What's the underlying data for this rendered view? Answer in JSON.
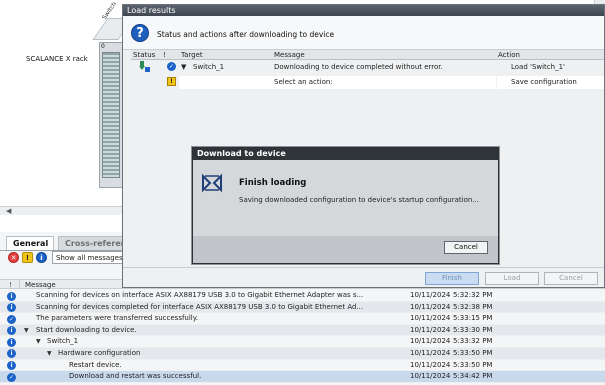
{
  "workspace": {
    "rack_label": "SCALANCE X rack",
    "rack_tab_label": "Switch",
    "rack_slot": "0"
  },
  "load_results": {
    "title": "Load results",
    "subtitle": "Status and actions after downloading to device",
    "columns": {
      "status": "Status",
      "info": "!",
      "target": "Target",
      "message": "Message",
      "action": "Action"
    },
    "rows": [
      {
        "target": "Switch_1",
        "message": "Downloading to device completed without error.",
        "action": "Load 'Switch_1'"
      },
      {
        "target": "",
        "message": "Select an action:",
        "action": "Save configuration"
      }
    ],
    "buttons": {
      "finish": "Finish",
      "load": "Load",
      "cancel": "Cancel"
    }
  },
  "download_dialog": {
    "title": "Download to device",
    "heading": "Finish loading",
    "detail": "Saving downloaded configuration to device's startup configuration...",
    "cancel_label": "Cancel"
  },
  "inspector": {
    "tabs": [
      "General",
      "Cross-referen"
    ],
    "filter_value": "Show all messages",
    "header": {
      "excl": "!",
      "message": "Message"
    },
    "log": [
      {
        "indent": 0,
        "arrow": "",
        "icon": "info",
        "text": "Scanning for devices on interface ASIX AX88179 USB 3.0 to Gigabit Ethernet Adapter was s...",
        "date": "10/11/2024",
        "time": "5:32:32 PM"
      },
      {
        "indent": 0,
        "arrow": "",
        "icon": "info",
        "text": "Scanning for devices completed for interface ASIX AX88179 USB 3.0 to Gigabit Ethernet Ad...",
        "date": "10/11/2024",
        "time": "5:32:38 PM"
      },
      {
        "indent": 0,
        "arrow": "",
        "icon": "ok",
        "text": "The parameters were transferred successfully.",
        "date": "10/11/2024",
        "time": "5:33:15 PM"
      },
      {
        "indent": 0,
        "arrow": "▼",
        "icon": "info",
        "text": "Start downloading to device.",
        "date": "10/11/2024",
        "time": "5:33:30 PM"
      },
      {
        "indent": 1,
        "arrow": "▼",
        "icon": "info",
        "text": "Switch_1",
        "date": "10/11/2024",
        "time": "5:33:32 PM"
      },
      {
        "indent": 2,
        "arrow": "▼",
        "icon": "info",
        "text": "Hardware configuration",
        "date": "10/11/2024",
        "time": "5:33:50 PM"
      },
      {
        "indent": 3,
        "arrow": "",
        "icon": "info",
        "text": "Restart device.",
        "date": "10/11/2024",
        "time": "5:33:50 PM"
      },
      {
        "indent": 3,
        "arrow": "",
        "icon": "ok",
        "text": "Download and restart was successful.",
        "date": "10/11/2024",
        "time": "5:34:42 PM"
      }
    ]
  },
  "colors": {
    "accent_blue": "#1b63c8",
    "titlebar_dark": "#2f3439",
    "selected_row": "#c9d9ec",
    "warning_yellow": "#f0c419",
    "error_red": "#e34040"
  }
}
